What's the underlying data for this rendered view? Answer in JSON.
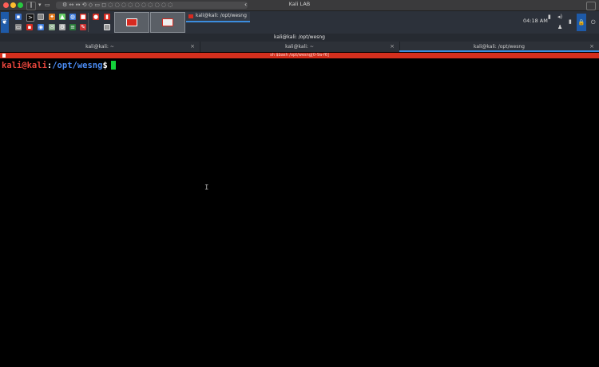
{
  "host": {
    "window_title": "Kali LAB",
    "traffic_lights": [
      "#ff5f57",
      "#febc2e",
      "#28c840"
    ]
  },
  "panel": {
    "clock": "04:18 AM",
    "task_label": "kali@kali: /opt/wesng",
    "colors": {
      "panel_bg": "#2c313a",
      "accent": "#3c8dde",
      "kali_red": "#d62a20"
    }
  },
  "terminal": {
    "window_title": "kali@kali: /opt/wesng",
    "tabs": [
      {
        "label": "kali@kali: ~",
        "active": false
      },
      {
        "label": "kali@kali: ~",
        "active": false
      },
      {
        "label": "kali@kali: /opt/wesng",
        "active": true
      }
    ],
    "alert_bar_text": "sh  $bash  /opt/wesng[0-9a-f6]",
    "prompt": {
      "user_host": "kali@kali",
      "colon": ":",
      "path": "/opt/wesng",
      "symbol": "$"
    },
    "colors": {
      "user_host": "#e8453c",
      "path": "#4a8cf5",
      "cursor": "#13d13a",
      "alert": "#d52f1d"
    }
  }
}
